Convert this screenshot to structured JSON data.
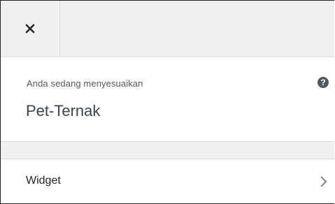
{
  "panel": {
    "close_icon": "close-icon",
    "customizing_label": "Anda sedang menyesuaikan",
    "site_title": "Pet-Ternak",
    "help_icon": "help-icon",
    "help_glyph": "?"
  },
  "sections": [
    {
      "label": "Widget",
      "icon": "chevron-right-icon"
    }
  ]
}
